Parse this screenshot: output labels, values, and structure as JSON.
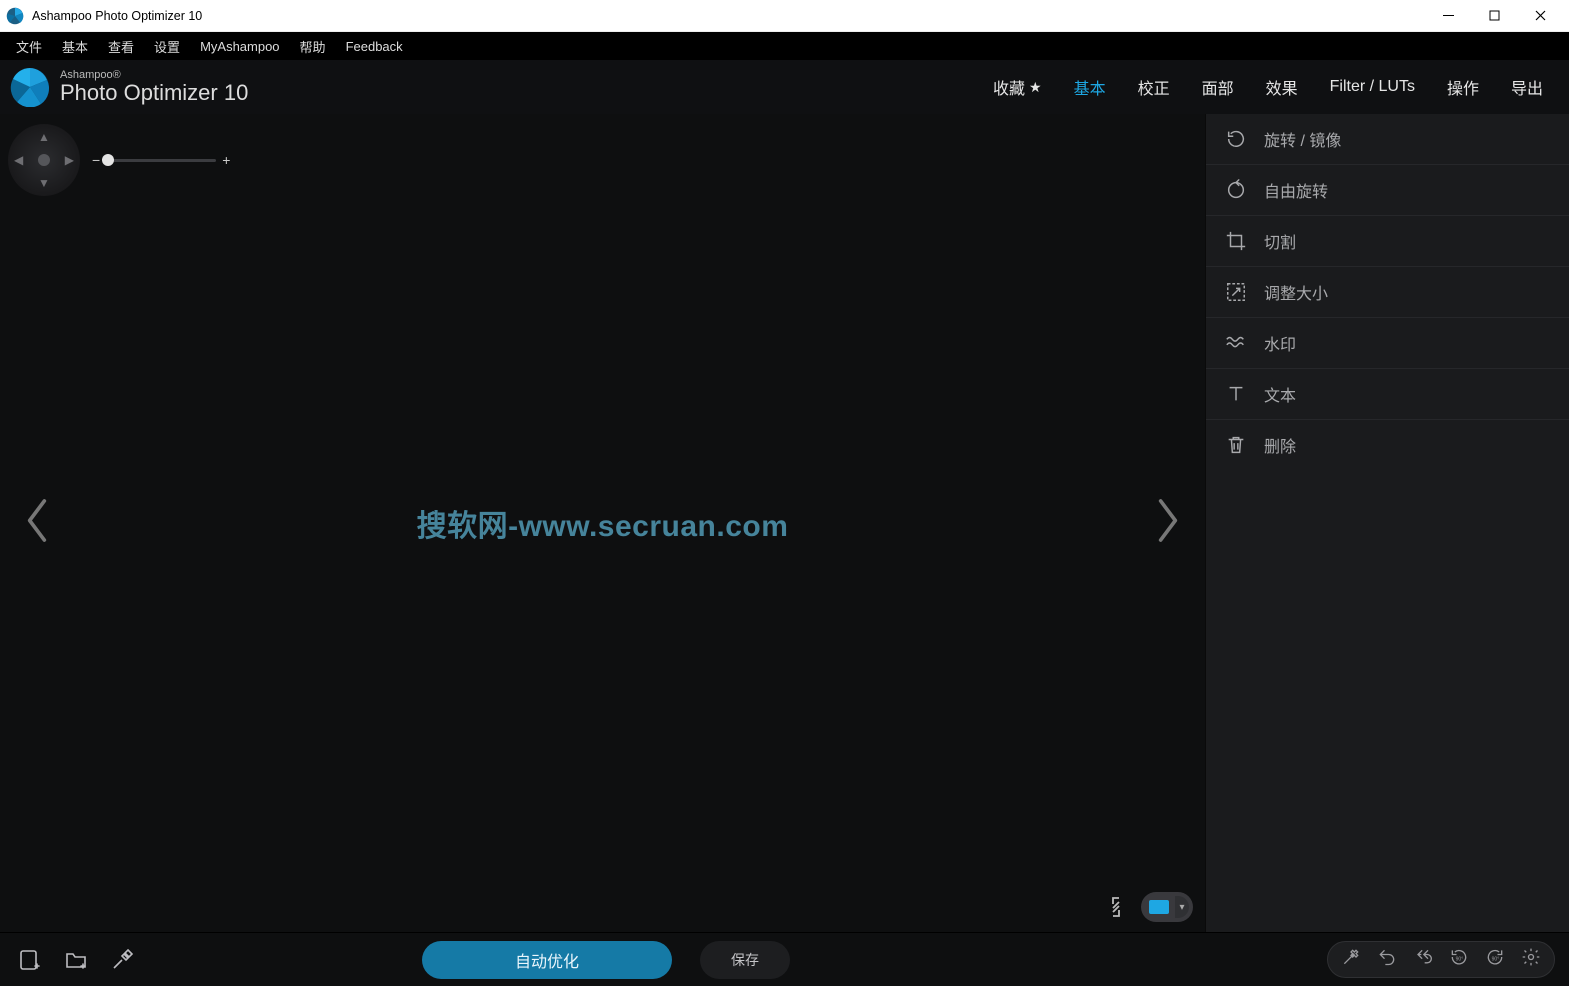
{
  "window": {
    "title": "Ashampoo Photo Optimizer 10"
  },
  "menubar": {
    "items": [
      {
        "label": "文件"
      },
      {
        "label": "基本"
      },
      {
        "label": "查看"
      },
      {
        "label": "设置"
      },
      {
        "label": "MyAshampoo"
      },
      {
        "label": "帮助"
      },
      {
        "label": "Feedback"
      }
    ]
  },
  "logo": {
    "brand": "Ashampoo®",
    "product": "Photo Optimizer 10"
  },
  "tabs": {
    "favorites_label": "收藏",
    "items": [
      {
        "label": "基本",
        "active": true
      },
      {
        "label": "校正"
      },
      {
        "label": "面部"
      },
      {
        "label": "效果"
      },
      {
        "label": "Filter / LUTs"
      },
      {
        "label": "操作"
      },
      {
        "label": "导出"
      }
    ]
  },
  "side_tools": {
    "items": [
      {
        "label": "旋转 / 镜像",
        "icon": "rotate-mirror"
      },
      {
        "label": "自由旋转",
        "icon": "free-rotate"
      },
      {
        "label": "切割",
        "icon": "crop"
      },
      {
        "label": "调整大小",
        "icon": "resize"
      },
      {
        "label": "水印",
        "icon": "watermark"
      },
      {
        "label": "文本",
        "icon": "text"
      },
      {
        "label": "删除",
        "icon": "delete"
      }
    ]
  },
  "canvas": {
    "watermark_text": "搜软网-www.secruan.com"
  },
  "zoom": {
    "minus": "−",
    "plus": "+"
  },
  "bottombar": {
    "auto_optimize_label": "自动优化",
    "save_label": "保存"
  },
  "colors": {
    "accent": "#1ea7e3"
  }
}
